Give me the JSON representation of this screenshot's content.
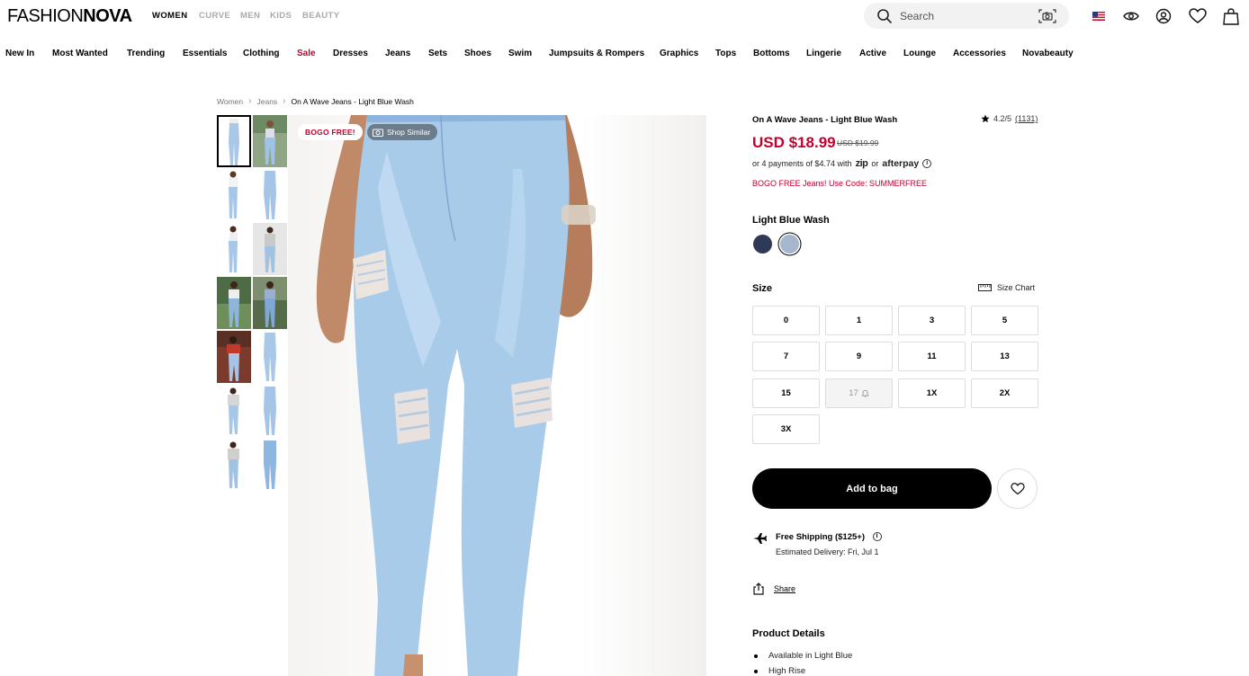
{
  "header": {
    "logo_part1": "FASHION",
    "logo_part2": "NOVA",
    "departments": [
      "WOMEN",
      "CURVE",
      "MEN",
      "KIDS",
      "BEAUTY"
    ],
    "active_department": "WOMEN",
    "search_placeholder": "Search",
    "icons": [
      "search-icon",
      "camera-search-icon",
      "us-flag-icon",
      "eye-icon",
      "account-icon",
      "wishlist-heart-icon",
      "shopping-bag-icon"
    ]
  },
  "nav": {
    "items": [
      "New In",
      "Most Wanted",
      "Trending",
      "Essentials",
      "Clothing",
      "Sale",
      "Dresses",
      "Jeans",
      "Sets",
      "Shoes",
      "Swim",
      "Jumpsuits & Rompers",
      "Graphics",
      "Tops",
      "Bottoms",
      "Lingerie",
      "Active",
      "Lounge",
      "Accessories",
      "Novabeauty"
    ],
    "highlight": "Sale",
    "highlight_color": "#c3002f"
  },
  "breadcrumb": [
    "Women",
    "Jeans",
    "On A Wave Jeans - Light Blue Wash"
  ],
  "gallery": {
    "badge_promo": "BOGO FREE!",
    "badge_similar": "Shop Similar"
  },
  "product": {
    "title": "On A Wave Jeans - Light Blue Wash",
    "rating": "4.2/5",
    "review_count": "(1131)",
    "price": "USD $18.99",
    "old_price": "USD $19.99",
    "installments_prefix": "or 4 payments of $4.74 with",
    "installments_zip": "zip",
    "installments_or": "or",
    "installments_afterpay": "afterpay",
    "promo": "BOGO FREE Jeans! Use Code: SUMMERFREE",
    "color_label": "Light Blue Wash",
    "swatches": [
      {
        "name": "Dark Wash",
        "color": "#2e3a55"
      },
      {
        "name": "Light Blue Wash",
        "color": "#a6b6cf",
        "selected": true
      }
    ],
    "size_label": "Size",
    "size_chart_label": "Size Chart",
    "sizes": [
      "0",
      "1",
      "3",
      "5",
      "7",
      "9",
      "11",
      "13",
      "15",
      "17",
      "1X",
      "2X",
      "3X"
    ],
    "out_of_stock_size": "17",
    "add_to_bag": "Add to bag",
    "shipping_title": "Free Shipping ($125+)",
    "shipping_date": "Estimated Delivery: Fri, Jul 1",
    "share_label": "Share",
    "details_heading": "Product Details",
    "details": [
      "Available in Light Blue",
      "High Rise"
    ]
  },
  "colors": {
    "accent_red": "#c3002f",
    "primary_black": "#000000"
  }
}
